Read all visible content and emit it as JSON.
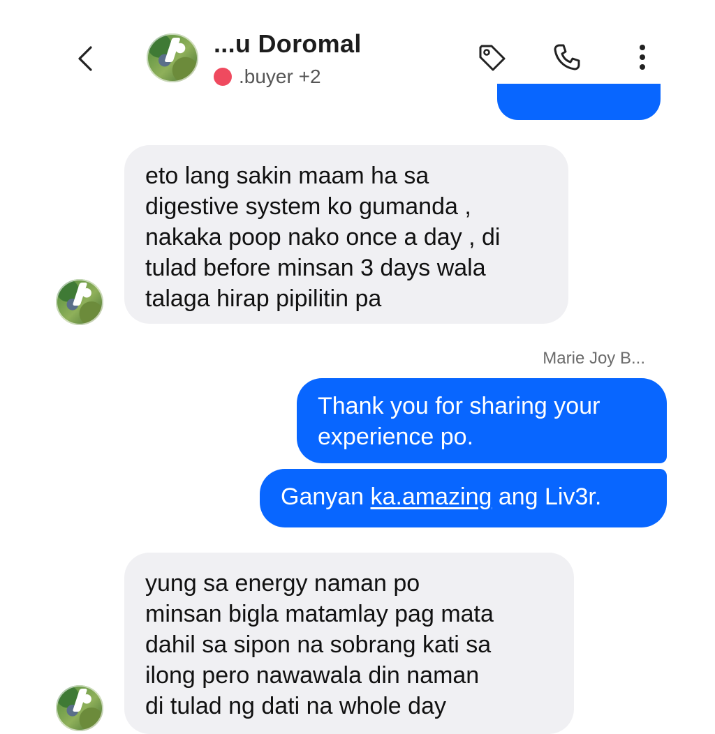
{
  "header": {
    "contact_name": "...u Doromal",
    "status_label": ".buyer +2",
    "status_color": "#ef4a5f",
    "icons": [
      "back-chevron-icon",
      "tag-icon",
      "phone-icon",
      "more-vertical-icon"
    ]
  },
  "messages": [
    {
      "direction": "incoming",
      "lines": [
        "eto lang sakin maam ha sa",
        "digestive system ko gumanda ,",
        "nakaka poop nako once a day , di",
        "tulad before minsan 3 days wala",
        "talaga hirap pipilitin pa"
      ]
    },
    {
      "direction": "outgoing",
      "sender": "Marie Joy B...",
      "lines": [
        "Thank you for sharing your",
        "experience po."
      ]
    },
    {
      "direction": "outgoing",
      "text_before": "Ganyan ",
      "link_text": "ka.amazing",
      "text_after": " ang Liv3r."
    },
    {
      "direction": "incoming",
      "lines": [
        "yung sa energy naman po",
        "minsan bigla matamlay pag mata",
        "dahil sa sipon na sobrang kati sa",
        "ilong pero nawawala din naman",
        "di tulad ng dati na whole day"
      ]
    }
  ],
  "colors": {
    "outgoing_bubble": "#0866ff",
    "incoming_bubble": "#f0f0f3"
  }
}
